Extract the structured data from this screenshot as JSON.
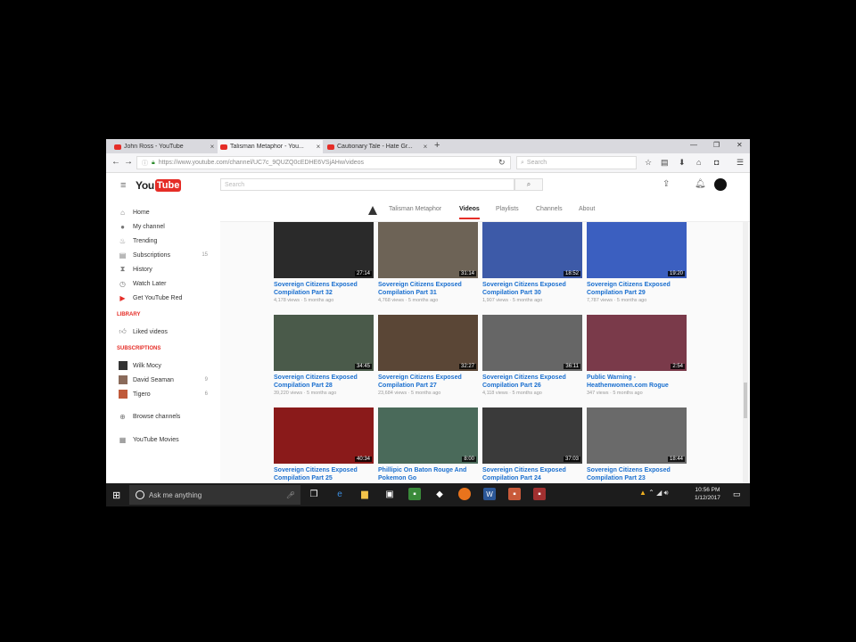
{
  "browser": {
    "tabs": [
      {
        "title": "John Ross - YouTube",
        "active": false
      },
      {
        "title": "Talisman Metaphor - You...",
        "active": true
      },
      {
        "title": "Cautionary Tale - Hate Gr...",
        "active": false
      }
    ],
    "url": "https://www.youtube.com/channel/UC7c_9QUZQ0cEDHE6VSjAHw/videos",
    "search_placeholder": "Search"
  },
  "youtube": {
    "logo_you": "You",
    "logo_tube": "Tube",
    "search_placeholder": "Search"
  },
  "sidebar": {
    "items": [
      {
        "label": "Home",
        "icon": "home-icon"
      },
      {
        "label": "My channel",
        "icon": "person-icon"
      },
      {
        "label": "Trending",
        "icon": "flame-icon"
      },
      {
        "label": "Subscriptions",
        "icon": "subscriptions-icon",
        "badge": "15"
      },
      {
        "label": "History",
        "icon": "history-icon"
      },
      {
        "label": "Watch Later",
        "icon": "clock-icon"
      },
      {
        "label": "Get YouTube Red",
        "icon": "youtube-red-icon"
      }
    ],
    "library_heading": "LIBRARY",
    "library_items": [
      {
        "label": "Liked videos",
        "icon": "thumbs-up-icon"
      }
    ],
    "subscriptions_heading": "SUBSCRIPTIONS",
    "subscriptions": [
      {
        "label": "Wilk Mocy",
        "badge": ""
      },
      {
        "label": "David Seaman",
        "badge": "9"
      },
      {
        "label": "Tigero",
        "badge": "6"
      }
    ],
    "browse_channels": "Browse channels",
    "youtube_movies": "YouTube Movies"
  },
  "channel": {
    "name": "Talisman Metaphor",
    "tabs": [
      "Videos",
      "Playlists",
      "Channels",
      "About"
    ],
    "active_tab": "Videos"
  },
  "videos": [
    {
      "title1": "Sovereign Citizens Exposed",
      "title2": "Compilation Part 32",
      "meta": "4,178 views · 5 months ago",
      "duration": "27:14",
      "thumb": "#2a2a2a"
    },
    {
      "title1": "Sovereign Citizens Exposed",
      "title2": "Compilation Part 31",
      "meta": "4,768 views · 5 months ago",
      "duration": "31:14",
      "thumb": "#6d6356"
    },
    {
      "title1": "Sovereign Citizens Exposed",
      "title2": "Compilation Part 30",
      "meta": "1,907 views · 5 months ago",
      "duration": "18:52",
      "thumb": "#3d5aa8"
    },
    {
      "title1": "Sovereign Citizens Exposed",
      "title2": "Compilation Part 29",
      "meta": "7,787 views · 5 months ago",
      "duration": "19:20",
      "thumb": "#3b5fc0"
    },
    {
      "title1": "Sovereign Citizens Exposed",
      "title2": "Compilation Part 28",
      "meta": "39,220 views · 5 months ago",
      "duration": "34:45",
      "thumb": "#4a5a4a"
    },
    {
      "title1": "Sovereign Citizens Exposed",
      "title2": "Compilation Part 27",
      "meta": "23,684 views · 5 months ago",
      "duration": "32:27",
      "thumb": "#5a4636"
    },
    {
      "title1": "Sovereign Citizens Exposed",
      "title2": "Compilation Part 26",
      "meta": "4,118 views · 5 months ago",
      "duration": "36:11",
      "thumb": "#666666"
    },
    {
      "title1": "Public Warning -",
      "title2": "Heathenwomen.com Rogue",
      "meta": "347 views · 5 months ago",
      "duration": "2:54",
      "thumb": "#7a3a4a"
    },
    {
      "title1": "Sovereign Citizens Exposed",
      "title2": "Compilation Part 25",
      "meta": "",
      "duration": "40:34",
      "thumb": "#8a1a1a"
    },
    {
      "title1": "Phillipic On Baton Rouge And",
      "title2": "Pokemon Go",
      "meta": "",
      "duration": "8:00",
      "thumb": "#4a6a5a"
    },
    {
      "title1": "Sovereign Citizens Exposed",
      "title2": "Compilation Part 24",
      "meta": "",
      "duration": "37:03",
      "thumb": "#3a3a3a"
    },
    {
      "title1": "Sovereign Citizens Exposed",
      "title2": "Compilation Part 23",
      "meta": "",
      "duration": "18:44",
      "thumb": "#6a6a6a"
    }
  ],
  "taskbar": {
    "search_placeholder": "Ask me anything",
    "time": "10:56 PM",
    "date": "1/12/2017"
  },
  "colors": {
    "brand": "#e52d27",
    "link": "#1a6fcf",
    "taskbar": "#1c1c1c"
  }
}
